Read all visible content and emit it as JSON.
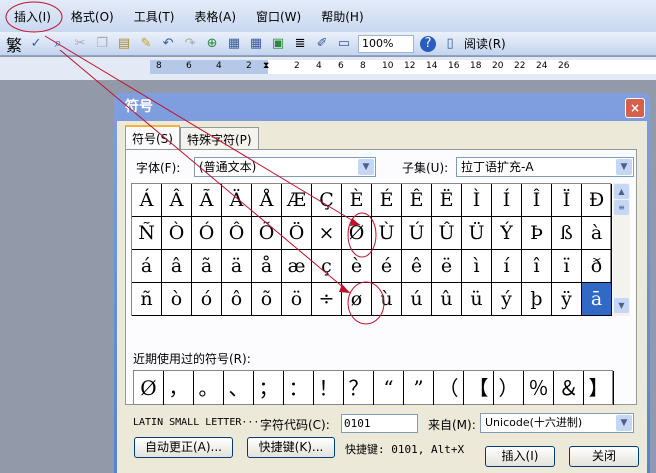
{
  "menu": [
    "插入(I)",
    "格式(O)",
    "工具(T)",
    "表格(A)",
    "窗口(W)",
    "帮助(H)"
  ],
  "toolbar": {
    "traditional": "繁",
    "zoom": "100%",
    "read": "阅读(R)"
  },
  "ruler": {
    "neg": [
      "8",
      "6",
      "4",
      "2"
    ],
    "pos": [
      "2",
      "4",
      "6",
      "8",
      "10",
      "12",
      "14",
      "16",
      "18",
      "20",
      "22",
      "24",
      "26"
    ]
  },
  "dialog": {
    "title": "符号",
    "close": "×",
    "tabs": [
      "符号(S)",
      "特殊字符(P)"
    ],
    "font_label": "字体(F):",
    "font_value": "(普通文本)",
    "subset_label": "子集(U):",
    "subset_value": "拉丁语扩充-A",
    "symbols": [
      "Á",
      "Â",
      "Ã",
      "Ä",
      "Å",
      "Æ",
      "Ç",
      "È",
      "É",
      "Ê",
      "Ë",
      "Ì",
      "Í",
      "Î",
      "Ï",
      "Ð",
      "Ñ",
      "Ò",
      "Ó",
      "Ô",
      "Õ",
      "Ö",
      "×",
      "Ø",
      "Ù",
      "Ú",
      "Û",
      "Ü",
      "Ý",
      "Þ",
      "ß",
      "à",
      "á",
      "â",
      "ã",
      "ä",
      "å",
      "æ",
      "ç",
      "è",
      "é",
      "ê",
      "ë",
      "ì",
      "í",
      "î",
      "ï",
      "ð",
      "ñ",
      "ò",
      "ó",
      "ô",
      "õ",
      "ö",
      "÷",
      "ø",
      "ù",
      "ú",
      "û",
      "ü",
      "ý",
      "þ",
      "ÿ",
      "ā"
    ],
    "selected_index": 63,
    "recent_label": "近期使用过的符号(R):",
    "recent": [
      "Ø",
      "，",
      "。",
      "、",
      "；",
      "：",
      "！",
      "？",
      "“",
      "”",
      "（",
      "【",
      "）",
      "％",
      "＆",
      "】"
    ],
    "char_name": "LATIN SMALL LETTER···",
    "code_label": "字符代码(C):",
    "code_value": "0101",
    "from_label": "来自(M):",
    "from_value": "Unicode(十六进制)",
    "autocorrect": "自动更正(A)...",
    "shortcut_btn": "快捷键(K)...",
    "shortcut_text": "快捷键: 0101, Alt+X",
    "insert": "插入(I)",
    "close_btn": "关闭"
  },
  "colors": {
    "annotation": "#c0102a",
    "selection": "#3169c6"
  }
}
